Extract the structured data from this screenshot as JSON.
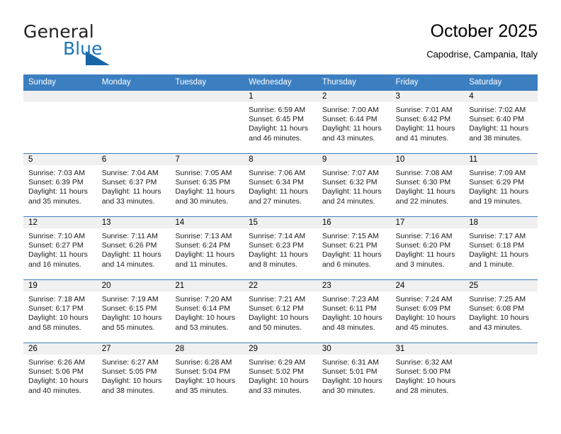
{
  "brand": {
    "name_part1": "General",
    "name_part2": "Blue",
    "logo_icon": "triangle-icon"
  },
  "header": {
    "title": "October 2025",
    "subtitle": "Capodrise, Campania, Italy"
  },
  "weekday_headers": [
    "Sunday",
    "Monday",
    "Tuesday",
    "Wednesday",
    "Thursday",
    "Friday",
    "Saturday"
  ],
  "colors": {
    "header_blue": "#3c7fc1",
    "brand_blue": "#1a74bb",
    "daynum_strip": "#f0f0f0",
    "text": "#000000"
  },
  "weeks": [
    [
      {
        "day": "",
        "sunrise": "",
        "sunset": "",
        "daylight": "",
        "blank": true
      },
      {
        "day": "",
        "sunrise": "",
        "sunset": "",
        "daylight": "",
        "blank": true
      },
      {
        "day": "",
        "sunrise": "",
        "sunset": "",
        "daylight": "",
        "blank": true
      },
      {
        "day": "1",
        "sunrise": "Sunrise: 6:59 AM",
        "sunset": "Sunset: 6:45 PM",
        "daylight": "Daylight: 11 hours and 46 minutes."
      },
      {
        "day": "2",
        "sunrise": "Sunrise: 7:00 AM",
        "sunset": "Sunset: 6:44 PM",
        "daylight": "Daylight: 11 hours and 43 minutes."
      },
      {
        "day": "3",
        "sunrise": "Sunrise: 7:01 AM",
        "sunset": "Sunset: 6:42 PM",
        "daylight": "Daylight: 11 hours and 41 minutes."
      },
      {
        "day": "4",
        "sunrise": "Sunrise: 7:02 AM",
        "sunset": "Sunset: 6:40 PM",
        "daylight": "Daylight: 11 hours and 38 minutes."
      }
    ],
    [
      {
        "day": "5",
        "sunrise": "Sunrise: 7:03 AM",
        "sunset": "Sunset: 6:39 PM",
        "daylight": "Daylight: 11 hours and 35 minutes."
      },
      {
        "day": "6",
        "sunrise": "Sunrise: 7:04 AM",
        "sunset": "Sunset: 6:37 PM",
        "daylight": "Daylight: 11 hours and 33 minutes."
      },
      {
        "day": "7",
        "sunrise": "Sunrise: 7:05 AM",
        "sunset": "Sunset: 6:35 PM",
        "daylight": "Daylight: 11 hours and 30 minutes."
      },
      {
        "day": "8",
        "sunrise": "Sunrise: 7:06 AM",
        "sunset": "Sunset: 6:34 PM",
        "daylight": "Daylight: 11 hours and 27 minutes."
      },
      {
        "day": "9",
        "sunrise": "Sunrise: 7:07 AM",
        "sunset": "Sunset: 6:32 PM",
        "daylight": "Daylight: 11 hours and 24 minutes."
      },
      {
        "day": "10",
        "sunrise": "Sunrise: 7:08 AM",
        "sunset": "Sunset: 6:30 PM",
        "daylight": "Daylight: 11 hours and 22 minutes."
      },
      {
        "day": "11",
        "sunrise": "Sunrise: 7:09 AM",
        "sunset": "Sunset: 6:29 PM",
        "daylight": "Daylight: 11 hours and 19 minutes."
      }
    ],
    [
      {
        "day": "12",
        "sunrise": "Sunrise: 7:10 AM",
        "sunset": "Sunset: 6:27 PM",
        "daylight": "Daylight: 11 hours and 16 minutes."
      },
      {
        "day": "13",
        "sunrise": "Sunrise: 7:11 AM",
        "sunset": "Sunset: 6:26 PM",
        "daylight": "Daylight: 11 hours and 14 minutes."
      },
      {
        "day": "14",
        "sunrise": "Sunrise: 7:13 AM",
        "sunset": "Sunset: 6:24 PM",
        "daylight": "Daylight: 11 hours and 11 minutes."
      },
      {
        "day": "15",
        "sunrise": "Sunrise: 7:14 AM",
        "sunset": "Sunset: 6:23 PM",
        "daylight": "Daylight: 11 hours and 8 minutes."
      },
      {
        "day": "16",
        "sunrise": "Sunrise: 7:15 AM",
        "sunset": "Sunset: 6:21 PM",
        "daylight": "Daylight: 11 hours and 6 minutes."
      },
      {
        "day": "17",
        "sunrise": "Sunrise: 7:16 AM",
        "sunset": "Sunset: 6:20 PM",
        "daylight": "Daylight: 11 hours and 3 minutes."
      },
      {
        "day": "18",
        "sunrise": "Sunrise: 7:17 AM",
        "sunset": "Sunset: 6:18 PM",
        "daylight": "Daylight: 11 hours and 1 minute."
      }
    ],
    [
      {
        "day": "19",
        "sunrise": "Sunrise: 7:18 AM",
        "sunset": "Sunset: 6:17 PM",
        "daylight": "Daylight: 10 hours and 58 minutes."
      },
      {
        "day": "20",
        "sunrise": "Sunrise: 7:19 AM",
        "sunset": "Sunset: 6:15 PM",
        "daylight": "Daylight: 10 hours and 55 minutes."
      },
      {
        "day": "21",
        "sunrise": "Sunrise: 7:20 AM",
        "sunset": "Sunset: 6:14 PM",
        "daylight": "Daylight: 10 hours and 53 minutes."
      },
      {
        "day": "22",
        "sunrise": "Sunrise: 7:21 AM",
        "sunset": "Sunset: 6:12 PM",
        "daylight": "Daylight: 10 hours and 50 minutes."
      },
      {
        "day": "23",
        "sunrise": "Sunrise: 7:23 AM",
        "sunset": "Sunset: 6:11 PM",
        "daylight": "Daylight: 10 hours and 48 minutes."
      },
      {
        "day": "24",
        "sunrise": "Sunrise: 7:24 AM",
        "sunset": "Sunset: 6:09 PM",
        "daylight": "Daylight: 10 hours and 45 minutes."
      },
      {
        "day": "25",
        "sunrise": "Sunrise: 7:25 AM",
        "sunset": "Sunset: 6:08 PM",
        "daylight": "Daylight: 10 hours and 43 minutes."
      }
    ],
    [
      {
        "day": "26",
        "sunrise": "Sunrise: 6:26 AM",
        "sunset": "Sunset: 5:06 PM",
        "daylight": "Daylight: 10 hours and 40 minutes."
      },
      {
        "day": "27",
        "sunrise": "Sunrise: 6:27 AM",
        "sunset": "Sunset: 5:05 PM",
        "daylight": "Daylight: 10 hours and 38 minutes."
      },
      {
        "day": "28",
        "sunrise": "Sunrise: 6:28 AM",
        "sunset": "Sunset: 5:04 PM",
        "daylight": "Daylight: 10 hours and 35 minutes."
      },
      {
        "day": "29",
        "sunrise": "Sunrise: 6:29 AM",
        "sunset": "Sunset: 5:02 PM",
        "daylight": "Daylight: 10 hours and 33 minutes."
      },
      {
        "day": "30",
        "sunrise": "Sunrise: 6:31 AM",
        "sunset": "Sunset: 5:01 PM",
        "daylight": "Daylight: 10 hours and 30 minutes."
      },
      {
        "day": "31",
        "sunrise": "Sunrise: 6:32 AM",
        "sunset": "Sunset: 5:00 PM",
        "daylight": "Daylight: 10 hours and 28 minutes."
      },
      {
        "day": "",
        "sunrise": "",
        "sunset": "",
        "daylight": "",
        "blank": true
      }
    ]
  ]
}
